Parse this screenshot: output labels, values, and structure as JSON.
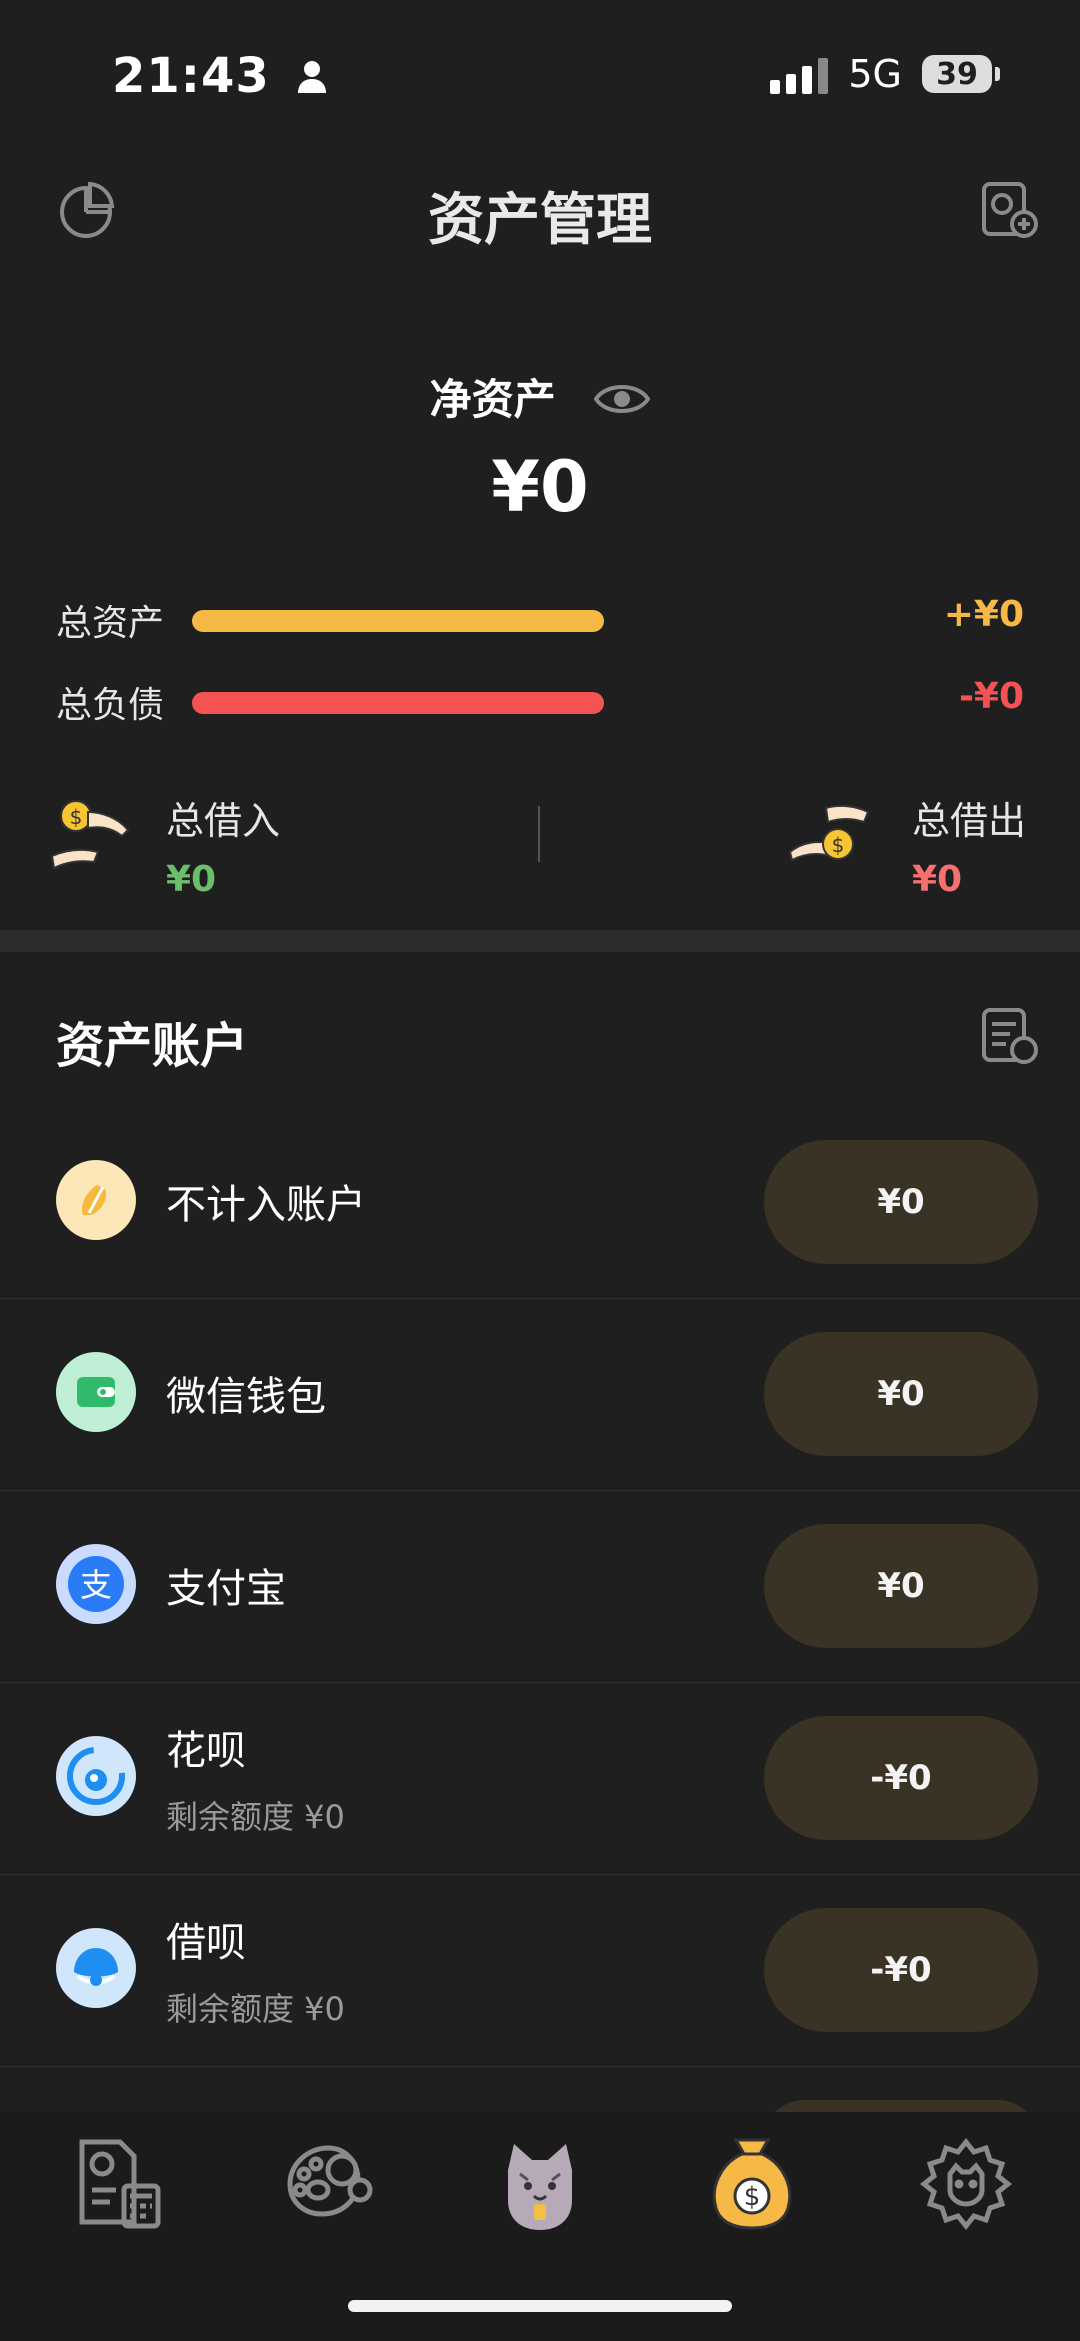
{
  "status": {
    "time": "21:43",
    "network": "5G",
    "battery": "39"
  },
  "header": {
    "title": "资产管理",
    "left_icon": "pie-chart-icon",
    "right_icon": "add-bill-icon"
  },
  "summary": {
    "net_label": "净资产",
    "net_value": "¥0",
    "total_assets_label": "总资产",
    "total_assets_value": "+¥0",
    "total_liabilities_label": "总负债",
    "total_liabilities_value": "-¥0",
    "borrow_in_label": "总借入",
    "borrow_in_value": "¥0",
    "lend_out_label": "总借出",
    "lend_out_value": "¥0"
  },
  "accounts_section": {
    "title": "资产账户"
  },
  "accounts": [
    {
      "name": "不计入账户",
      "sub": "",
      "amount": "¥0"
    },
    {
      "name": "微信钱包",
      "sub": "",
      "amount": "¥0"
    },
    {
      "name": "支付宝",
      "sub": "",
      "amount": "¥0"
    },
    {
      "name": "花呗",
      "sub": "剩余额度 ¥0",
      "amount": "-¥0"
    },
    {
      "name": "借呗",
      "sub": "剩余额度 ¥0",
      "amount": "-¥0"
    }
  ],
  "colors": {
    "accent": "#f7b946",
    "negative": "#f55353",
    "positive": "#6bbf6b",
    "background": "#1f1f1f"
  },
  "tabs": [
    "bill-icon",
    "cat-paw-money-icon",
    "cat-mascot-icon",
    "money-bag-icon",
    "cat-settings-icon"
  ]
}
